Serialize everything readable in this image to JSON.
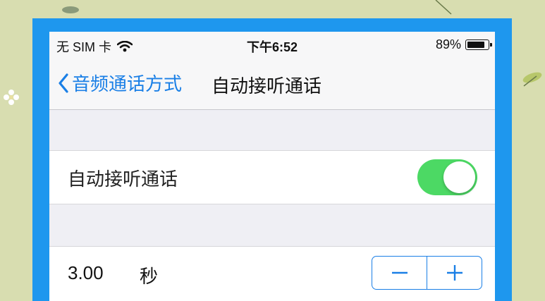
{
  "status_bar": {
    "carrier": "无 SIM 卡",
    "time": "下午6:52",
    "battery_percent": "89%",
    "battery_level": 0.89,
    "wifi_icon": "wifi-icon"
  },
  "nav": {
    "back_label": "音频通话方式",
    "title": "自动接听通话"
  },
  "auto_answer": {
    "label": "自动接听通话",
    "enabled": true
  },
  "delay": {
    "value": "3.00",
    "unit": "秒",
    "decrement_icon": "minus-icon",
    "increment_icon": "plus-icon"
  },
  "colors": {
    "accent": "#1a7fe6",
    "toggle_on": "#4cd964",
    "frame": "#1e97ee",
    "background": "#efeff4"
  }
}
